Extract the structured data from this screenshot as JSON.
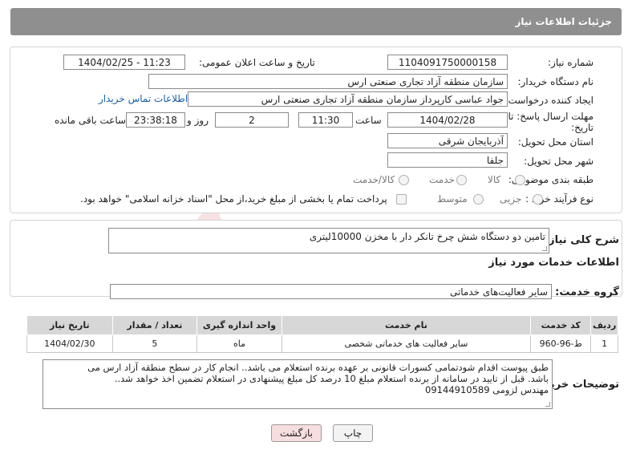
{
  "header": {
    "title": "جزئیات اطلاعات نیاز"
  },
  "form": {
    "need_number_label": "شماره نیاز:",
    "need_number": "1104091750000158",
    "announce_label": "تاریخ و ساعت اعلان عمومی:",
    "announce_value": "1404/02/25 - 11:23",
    "buyer_org_label": "نام دستگاه خریدار:",
    "buyer_org": "سازمان منطقه آزاد تجاری صنعتی ارس",
    "creator_label": "ایجاد کننده درخواست:",
    "creator": "جواد عباسی کارپرداز سازمان منطقه آزاد تجاری صنعتی ارس",
    "contact_link": "اطلاعات تماس خریدار",
    "deadline_label_1": "مهلت ارسال پاسخ: تا",
    "deadline_label_2": "تاریخ:",
    "deadline_date": "1404/02/28",
    "time_label": "ساعت",
    "deadline_time": "11:30",
    "days_value": "2",
    "days_label": "روز و",
    "remaining_time": "23:38:18",
    "remaining_label": "ساعت باقی مانده",
    "province_label": "استان محل تحویل:",
    "province": "آذربایجان شرقی",
    "city_label": "شهر محل تحویل:",
    "city": "جلفا",
    "category_label": "طبقه بندی موضوعی:",
    "category_options": [
      "کالا",
      "خدمت",
      "کالا/خدمت"
    ],
    "process_label": "نوع فرآیند خرید :",
    "process_options": [
      "جزیی",
      "متوسط"
    ],
    "payment_note": "پرداخت تمام یا بخشی از مبلغ خرید،از محل \"اسناد خزانه اسلامی\" خواهد بود."
  },
  "summary": {
    "label": "شرح کلی نیاز:",
    "value": "تامین دو دستگاه شش چرخ تانکر دار با مخزن 10000لیتری"
  },
  "services": {
    "section_title": "اطلاعات خدمات مورد نیاز",
    "group_label": "گروه خدمت:",
    "group_value": "سایر فعالیت‌های خدماتی",
    "columns": [
      "ردیف",
      "کد خدمت",
      "نام خدمت",
      "واحد اندازه گیری",
      "تعداد / مقدار",
      "تاریخ نیاز"
    ],
    "rows": [
      [
        "1",
        "ط-96-960",
        "سایر فعالیت های خدماتی شخصی",
        "ماه",
        "5",
        "1404/02/30"
      ]
    ]
  },
  "notes": {
    "label": "توضیحات خریدار:",
    "line1": "طبق پیوست اقدام شودتمامی کسورات قانونی بر عهده برنده استعلام می باشد.. انجام کار در سطح منطقه آزاد ارس می",
    "line2": "باشد. قبل از تایید در سامانه  از برنده استعلام مبلغ 10 درصد کل مبلغ پیشنهادی در استعلام تضمین اخذ خواهد شد..",
    "line3": "مهندس  لزومی 09144910589"
  },
  "buttons": {
    "print": "چاپ",
    "back": "بازگشت"
  },
  "watermark": {
    "text": "AriaTender.neT"
  },
  "colors": {
    "header_bg": "#8f8f8f",
    "table_header_bg": "#d7d7d7",
    "link": "#1a5fa8",
    "back_btn_bg": "#f7dede",
    "watermark": "#c62828"
  }
}
